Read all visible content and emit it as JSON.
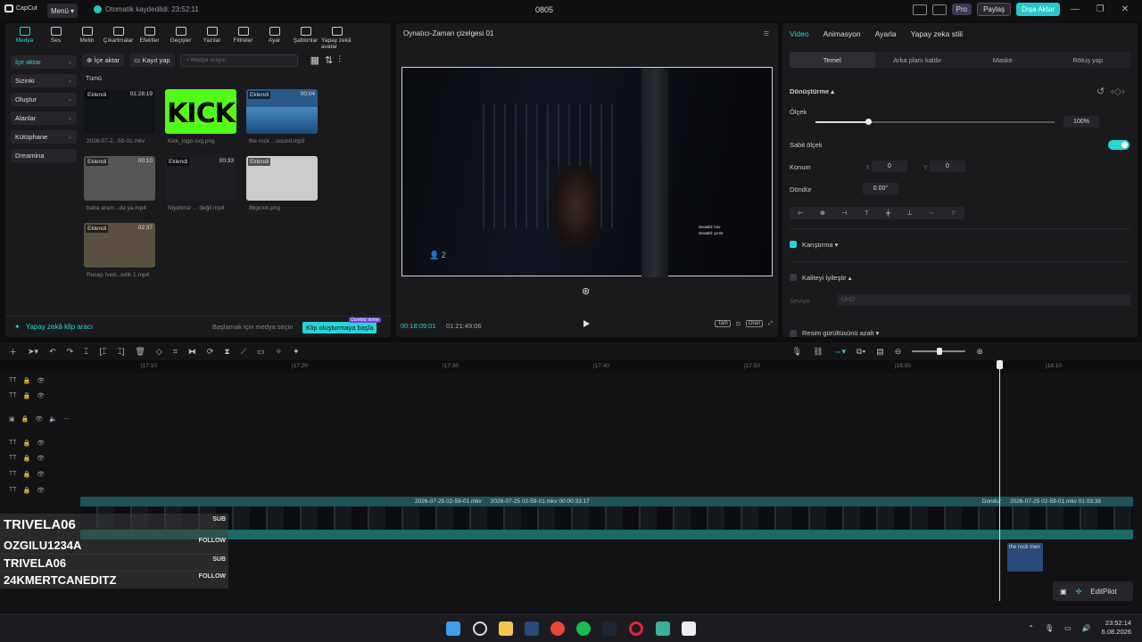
{
  "titlebar": {
    "app": "CapCut",
    "menu": "Menü",
    "autosave": "Otomatik kaydedildi: 23:52:11",
    "project": "0805",
    "pro": "Pro",
    "share": "Paylaş",
    "export": "Dışa Aktar"
  },
  "toptabs": [
    {
      "label": "Medya",
      "icon": "media-icon"
    },
    {
      "label": "Ses",
      "icon": "audio-icon"
    },
    {
      "label": "Metin",
      "icon": "text-icon"
    },
    {
      "label": "Çıkartmalar",
      "icon": "sticker-icon"
    },
    {
      "label": "Efektler",
      "icon": "effects-icon"
    },
    {
      "label": "Geçişler",
      "icon": "transition-icon"
    },
    {
      "label": "Yazılar",
      "icon": "caption-icon"
    },
    {
      "label": "Filtreler",
      "icon": "filter-icon"
    },
    {
      "label": "Ayar",
      "icon": "adjust-icon"
    },
    {
      "label": "Şablonlar",
      "icon": "template-icon"
    },
    {
      "label": "Yapay zekâ avatar",
      "icon": "avatar-icon"
    }
  ],
  "sidebar": [
    {
      "label": "İçe aktar"
    },
    {
      "label": "Sizinki"
    },
    {
      "label": "Oluştur"
    },
    {
      "label": "Alanlar"
    },
    {
      "label": "Kütüphane"
    },
    {
      "label": "Dreamina"
    }
  ],
  "mediabar": {
    "import": "İçe aktar",
    "record": "Kayıt yap",
    "search_placeholder": "Medya arayın",
    "all": "Tümü"
  },
  "media": [
    {
      "badge": "Eklendi",
      "dur": "01:28:19",
      "name": "2026-07-2...59-01.mkv",
      "color": "#111418"
    },
    {
      "badge": "",
      "dur": "",
      "name": "Kick_logo.svg.png",
      "color": "#53fc18"
    },
    {
      "badge": "Eklendi",
      "dur": "00:04",
      "name": "the rock ...sound.mp3",
      "color": "#2a5a8a"
    },
    {
      "badge": "Eklendi",
      "dur": "00:10",
      "name": "baba aram...da ya.mp4",
      "color": "#555"
    },
    {
      "badge": "Eklendi",
      "dur": "00:33",
      "name": "Niyetimiz ... değil.mp4",
      "color": "#1c1e22"
    },
    {
      "badge": "Eklendi",
      "dur": "",
      "name": "8bgcxin.png",
      "color": "#ccc"
    },
    {
      "badge": "Eklendi",
      "dur": "02:37",
      "name": "Recep İved...edik 1.mp4",
      "color": "#5a5040"
    }
  ],
  "kick_text": "KICK",
  "aibar": {
    "title": "Yapay zekâ klip aracı",
    "hint": "Başlamak için medya seçin",
    "start": "Klip oluşturmaya başla",
    "free": "Ücretsiz deme"
  },
  "player": {
    "title": "Oynatıcı-Zaman çizelgesi 01",
    "current": "00:18:09:01",
    "total": "01:21:49:06",
    "full": "Tam",
    "ratio": "Oran",
    "hud_line1": "Snowbl: hov",
    "hud_line2": "Snowbl: yo M",
    "players": "2"
  },
  "props": {
    "tabs": [
      "Video",
      "Animasyon",
      "Ayarla",
      "Yapay zeka stili"
    ],
    "subtabs": [
      "Temel",
      "Arka planı kaldır",
      "Maske",
      "Rötuş yap"
    ],
    "transform": "Dönüştürme",
    "scale": "Ölçek",
    "scale_value": "100%",
    "scale_fraction": 0.22,
    "uniform": "Sabit ölçek",
    "position": "Konum",
    "x_label": "X",
    "x_val": "0",
    "y_label": "Y",
    "y_val": "0",
    "rotate": "Döndür",
    "rotate_val": "0.00°",
    "blend": "Karıştırma",
    "quality": "Kaliteyi İyileştir",
    "quality_level": "Seviye",
    "quality_opt": "UHD",
    "noise": "Resim gürültüsünü azalt"
  },
  "timeline": {
    "ruler": [
      "|17:10",
      "|17:20",
      "|17:30",
      "|17:40",
      "|17:50",
      "|18:00",
      "|18:10"
    ],
    "clip1": "2026-07-25 02-59-01.mkv",
    "clip2": "2026-07-25 02-59-01.mkv  00:00:33:17",
    "clip3": "Dondur",
    "clip4": "2026-07-25 02-59-01.mkv  01:03:38",
    "audio": "the rock men",
    "editpilot": "EditPilot"
  },
  "chat": [
    {
      "name": "TRIVELA06",
      "role": "SUB"
    },
    {
      "name": "OZGILU1234A",
      "role": "FOLLOW"
    },
    {
      "name": "TRIVELA06",
      "role": "SUB"
    },
    {
      "name": "24KMERTCANEDITZ",
      "role": "FOLLOW"
    }
  ],
  "taskbar": {
    "time": "23:52:14",
    "date": "6.08.2026"
  }
}
